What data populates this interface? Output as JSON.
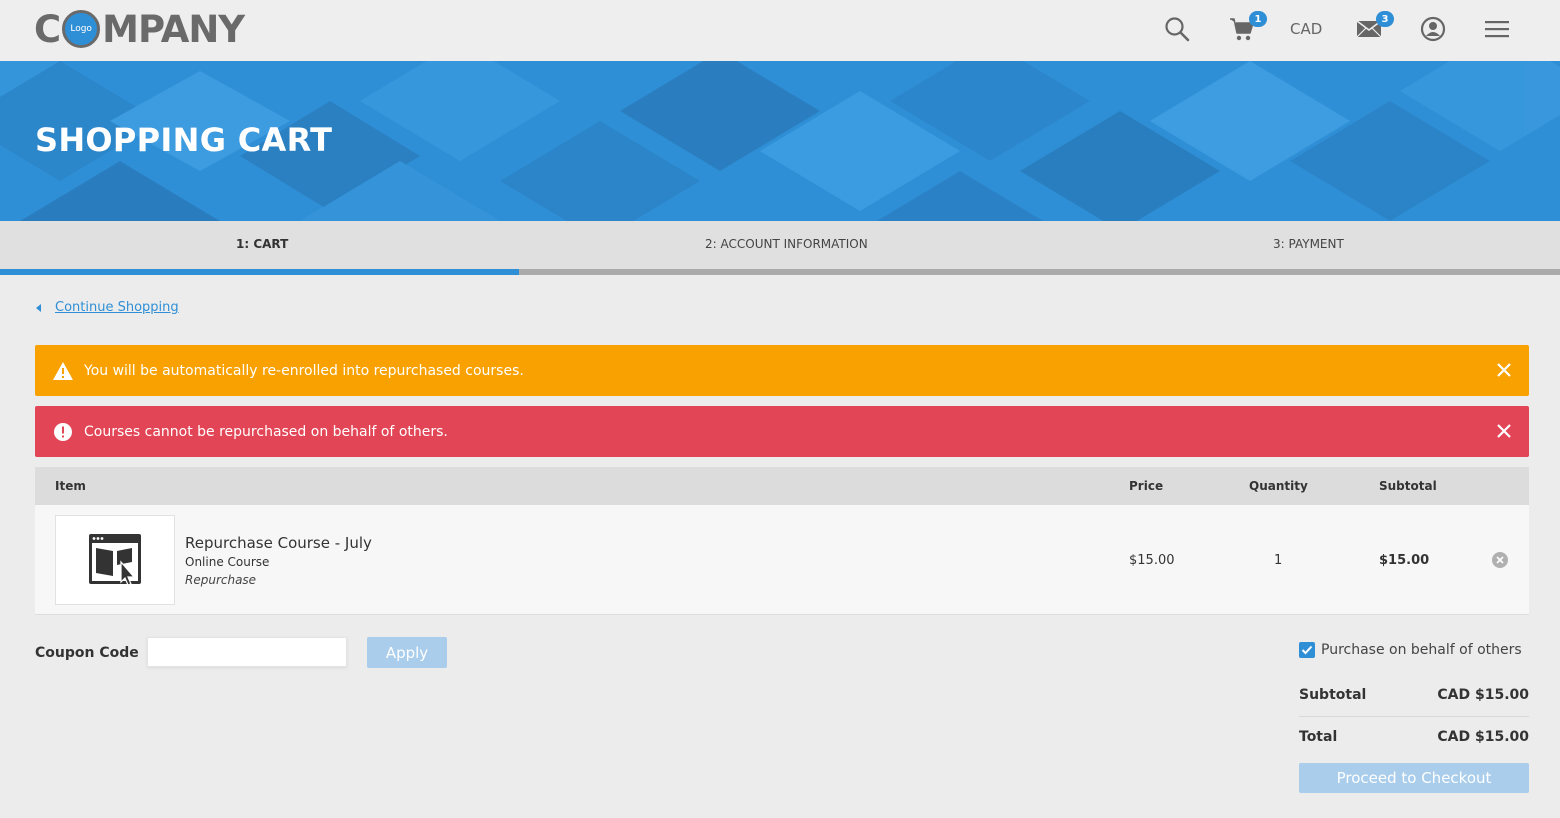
{
  "header": {
    "logo_text_pre": "C",
    "logo_badge": "Logo",
    "logo_text_post": "MPANY",
    "cart_count": "1",
    "currency": "CAD",
    "messages_count": "3",
    "icons": [
      "search-icon",
      "cart-icon",
      "mail-icon",
      "user-icon",
      "menu-icon"
    ]
  },
  "banner": {
    "title": "SHOPPING CART"
  },
  "steps": {
    "items": [
      "1: CART",
      "2: ACCOUNT INFORMATION",
      "3: PAYMENT"
    ],
    "active_index": 0,
    "progress_fraction": 0.333
  },
  "nav": {
    "continue_label": "Continue Shopping"
  },
  "alerts": {
    "warning": "You will be automatically re-enrolled into repurchased courses.",
    "error": "Courses cannot be repurchased on behalf of others."
  },
  "table": {
    "headers": {
      "item": "Item",
      "price": "Price",
      "quantity": "Quantity",
      "subtotal": "Subtotal"
    },
    "rows": [
      {
        "name": "Repurchase Course - July",
        "type": "Online Course",
        "tag": "Repurchase",
        "price": "$15.00",
        "quantity": "1",
        "subtotal": "$15.00",
        "icon": "course-icon"
      }
    ]
  },
  "coupon": {
    "label": "Coupon Code",
    "value": "",
    "apply_label": "Apply"
  },
  "summary": {
    "behalf_label": "Purchase on behalf of others",
    "behalf_checked": true,
    "subtotal_label": "Subtotal",
    "subtotal_value": "CAD $15.00",
    "total_label": "Total",
    "total_value": "CAD $15.00",
    "checkout_label": "Proceed to Checkout"
  },
  "colors": {
    "accent": "#2f8fd6",
    "warning": "#f8a100",
    "error": "#e24555",
    "disabled_button": "#a9cdeb"
  }
}
